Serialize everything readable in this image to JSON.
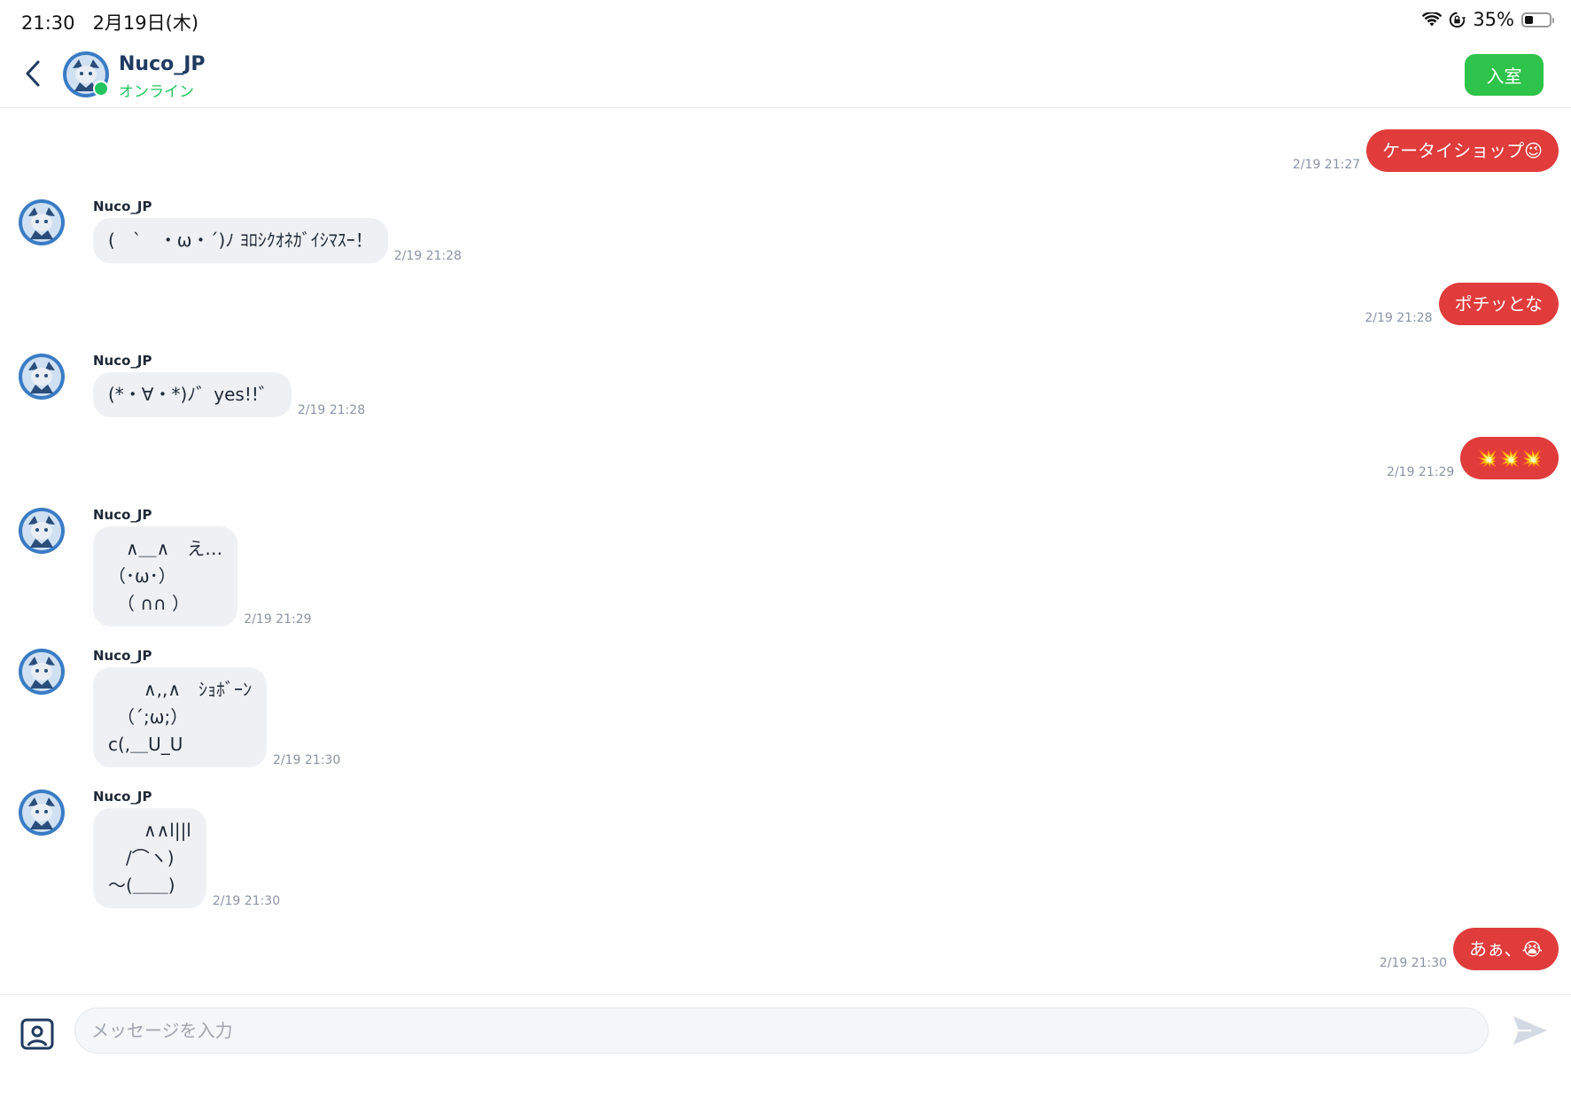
{
  "status_bar": {
    "time": "21:30",
    "date": "2月19日(木)",
    "battery": "35%",
    "battery_level": 0.35
  },
  "header": {
    "contact_name": "Nuco_JP",
    "contact_status": "オンライン",
    "enter_button_label": "入室"
  },
  "messages": [
    {
      "direction": "out",
      "text": "ケータイショップ😉",
      "time": "2/19 21:27"
    },
    {
      "direction": "in",
      "name": "Nuco_JP",
      "text": "(　`　・ω・´)ﾉ ﾖﾛｼｸｵﾈｶﾞｲｼﾏｽｰ！",
      "time": "2/19 21:28"
    },
    {
      "direction": "out",
      "text": "ポチッとな",
      "time": "2/19 21:28"
    },
    {
      "direction": "in",
      "name": "Nuco_JP",
      "text": "(*・∀・*)ﾉ゛yes!!゛",
      "time": "2/19 21:28"
    },
    {
      "direction": "out",
      "text": "💥💥💥",
      "time": "2/19 21:29"
    },
    {
      "direction": "in",
      "name": "Nuco_JP",
      "text": "　∧＿∧　え…\n（･ω･）\n　（ ∩∩ ）",
      "time": "2/19 21:29"
    },
    {
      "direction": "in",
      "name": "Nuco_JP",
      "text": "　　∧,,∧　ｼｮﾎﾞｰﾝ\n　（´;ω;）\nc(,＿U_U",
      "time": "2/19 21:30"
    },
    {
      "direction": "in",
      "name": "Nuco_JP",
      "text": "　　∧∧l||l\n　/⌒ヽ)\n〜(＿＿)",
      "time": "2/19 21:30"
    },
    {
      "direction": "out",
      "text": "あぁ、😭",
      "time": "2/19 21:30"
    }
  ],
  "composer": {
    "placeholder": "メッセージを入力"
  },
  "colors": {
    "accent_red": "#e03c3c",
    "online_green": "#2ec34a",
    "bubble_in": "#eef0f3"
  },
  "icons": {
    "back": "chevron-left-icon",
    "image": "image-icon",
    "send": "send-icon",
    "wifi": "wifi-icon",
    "lock_rotation": "rotation-lock-icon",
    "battery": "battery-icon"
  }
}
